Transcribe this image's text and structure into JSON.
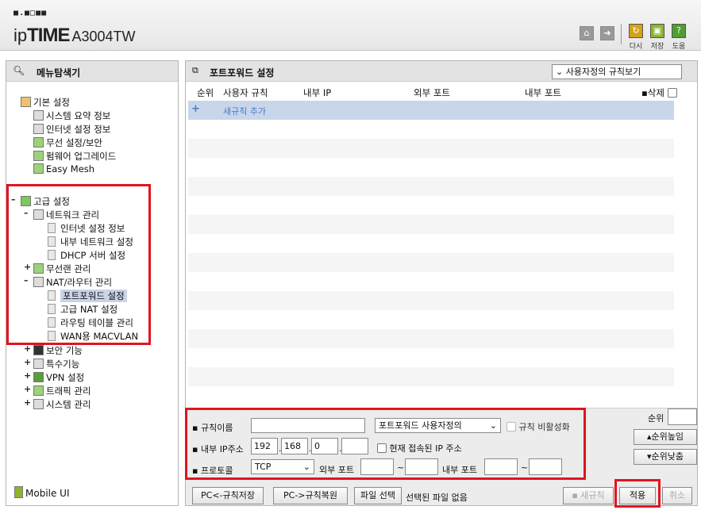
{
  "header": {
    "logo_dots": "■.■□■■",
    "brand_prefix": "ip",
    "brand_bold": "TIME",
    "model": "A3004TW",
    "actions": [
      {
        "label": "다시",
        "icon": "refresh-icon",
        "color": "#d4a21a"
      },
      {
        "label": "저장",
        "icon": "save-icon",
        "color": "#8db52a"
      },
      {
        "label": "도움",
        "icon": "help-icon",
        "color": "#4f9e2f"
      }
    ],
    "home_icon": "home-icon",
    "logout_icon": "logout-icon"
  },
  "sidebar": {
    "title": "메뉴탐색기",
    "basic": {
      "label": "기본 설정",
      "items": [
        "시스템 요약 정보",
        "인터넷 설정 정보",
        "무선 설정/보안",
        "펌웨어 업그레이드",
        "Easy Mesh"
      ]
    },
    "advanced": {
      "label": "고급 설정",
      "network": {
        "label": "네트워크 관리",
        "items": [
          "인터넷 설정 정보",
          "내부 네트워크 설정",
          "DHCP 서버 설정"
        ]
      },
      "wireless_lan": "무선랜 관리",
      "nat": {
        "label": "NAT/라우터 관리",
        "items": [
          "포트포워드 설정",
          "고급 NAT 설정",
          "라우팅 테이블 관리",
          "WAN용 MACVLAN"
        ]
      },
      "others": [
        "보안 기능",
        "특수기능",
        "VPN 설정",
        "트래픽 관리",
        "시스템 관리"
      ]
    },
    "mobile_ui": "Mobile UI"
  },
  "main": {
    "title": "포트포워드 설정",
    "view_select": "사용자정의 규칙보기",
    "columns": [
      "순위",
      "사용자 규칙",
      "내부 IP",
      "외부 포트",
      "내부 포트"
    ],
    "delete_label": "삭제",
    "add_rule": "새규칙 추가",
    "add_symbol": "+"
  },
  "form": {
    "rule_name_label": "규칙이름",
    "rule_name_value": "",
    "rule_type": "포트포워드 사용자정의",
    "disable_rule_label": "규칙 비활성화",
    "internal_ip_label": "내부 IP주소",
    "ip": [
      "192",
      "168",
      "0",
      ""
    ],
    "current_ip_label": "현재 접속된 IP 주소",
    "protocol_label": "프로토콜",
    "protocol": "TCP",
    "external_port_label": "외부 포트",
    "internal_port_label": "내부 포트",
    "tilde": "~",
    "priority_label": "순위",
    "raise_label": "순위높임",
    "lower_label": "순위낮춤"
  },
  "buttons": {
    "save_rules": "PC<-규칙저장",
    "restore_rules": "PC->규칙복원",
    "file_select": "파일 선택",
    "no_file": "선택된 파일 없음",
    "new_rule": "새규칙",
    "apply": "적용",
    "cancel": "취소"
  }
}
